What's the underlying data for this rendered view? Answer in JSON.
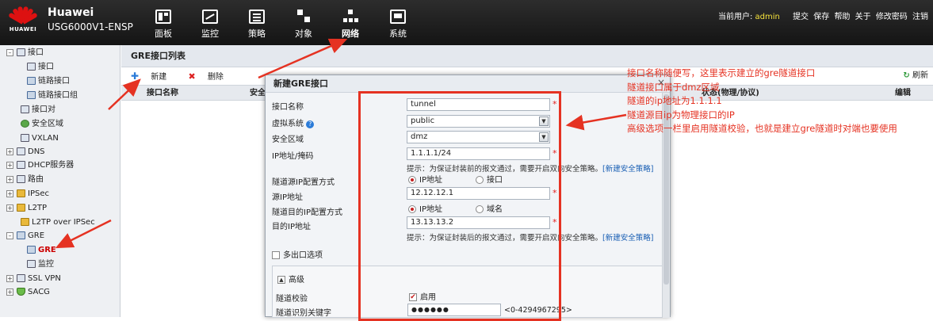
{
  "header": {
    "brand": "Huawei",
    "logo_text": "HUAWEI",
    "model": "USG6000V1-ENSP",
    "nav": [
      {
        "label": "面板",
        "icon": "dashboard-icon"
      },
      {
        "label": "监控",
        "icon": "monitor-icon"
      },
      {
        "label": "策略",
        "icon": "policy-icon"
      },
      {
        "label": "对象",
        "icon": "object-icon"
      },
      {
        "label": "网络",
        "icon": "network-icon"
      },
      {
        "label": "系统",
        "icon": "system-icon"
      }
    ],
    "user_label": "当前用户:",
    "user_name": "admin",
    "links": [
      "提交",
      "保存",
      "帮助",
      "关于",
      "修改密码",
      "注销"
    ]
  },
  "tree": {
    "items": [
      {
        "label": "接口",
        "toggle": "–"
      },
      {
        "label": "接口"
      },
      {
        "label": "链路接口"
      },
      {
        "label": "链路接口组"
      },
      {
        "label": "接口对"
      },
      {
        "label": "安全区域"
      },
      {
        "label": "VXLAN"
      },
      {
        "label": "DNS",
        "toggle": "+"
      },
      {
        "label": "DHCP服务器",
        "toggle": "+"
      },
      {
        "label": "路由",
        "toggle": "+"
      },
      {
        "label": "IPSec",
        "toggle": "+"
      },
      {
        "label": "L2TP",
        "toggle": "+"
      },
      {
        "label": "L2TP over IPSec"
      },
      {
        "label": "GRE",
        "toggle": "–"
      },
      {
        "label": "GRE"
      },
      {
        "label": "监控"
      },
      {
        "label": "SSL VPN",
        "toggle": "+"
      },
      {
        "label": "SACG",
        "toggle": "+"
      }
    ]
  },
  "main": {
    "title": "GRE接口列表",
    "new_label": "新建",
    "delete_label": "删除",
    "refresh_label": "刷新",
    "columns": [
      "接口名称",
      "安全",
      "状态(物理/协议)",
      "编辑"
    ]
  },
  "dialog": {
    "title": "新建GRE接口",
    "close": "×",
    "fields": {
      "name_label": "接口名称",
      "name_value": "tunnel",
      "vsys_label": "虚拟系统",
      "vsys_value": "public",
      "zone_label": "安全区域",
      "zone_value": "dmz",
      "ip_label": "IP地址/掩码",
      "ip_value": "1.1.1.1/24",
      "hint1": "提示：为保证封装前的报文通过，需要开启双向安全策略。",
      "hint_link": "[新建安全策略]",
      "src_mode_label": "隧道源IP配置方式",
      "opt_ip": "IP地址",
      "opt_intf": "接口",
      "src_ip_label": "源IP地址",
      "src_ip_value": "12.12.12.1",
      "dst_mode_label": "隧道目的IP配置方式",
      "opt_domain": "域名",
      "dst_ip_label": "目的IP地址",
      "dst_ip_value": "13.13.13.2",
      "hint2": "提示：为保证封装后的报文通过，需要开启双向安全策略。",
      "multi_label": "多出口选项",
      "adv_label": "高级",
      "check_label": "隧道校验",
      "check_value": "启用",
      "key_label": "隧道识别关键字",
      "key_value": "●●●●●●",
      "key_range": "<0-4294967295>"
    }
  },
  "annotations": [
    "接口名称随便写，这里表示建立的gre隧道接口",
    "隧道接口属于dmz区域",
    "隧道的ip地址为1.1.1.1",
    "隧道源目ip为物理接口的IP",
    "高级选项一栏里启用隧道校验，也就是建立gre隧道时对端也要使用"
  ],
  "colors": {
    "annotation": "#e53222",
    "header_bg": "#1e1e1e",
    "accent_user": "#f6e33c"
  }
}
